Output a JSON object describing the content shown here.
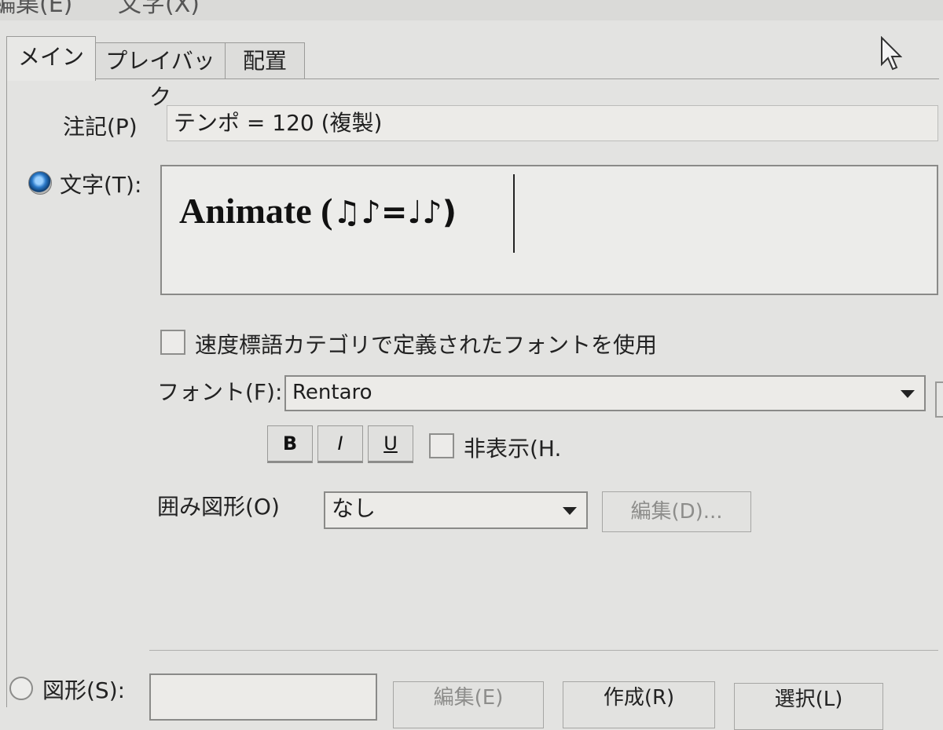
{
  "menubar": {
    "items": [
      "編集(E)",
      "文字(X)"
    ]
  },
  "tabs": [
    {
      "label": "メイン",
      "active": true
    },
    {
      "label": "プレイバック",
      "active": false
    },
    {
      "label": "配置",
      "active": false
    }
  ],
  "annotation": {
    "label": "注記(P)",
    "value": "テンポ = 120 (複製)"
  },
  "text_option": {
    "label": "文字(T):",
    "selected": true,
    "content": "Animate (",
    "content_symbols": "♫♪=♩♪)"
  },
  "tempo_font_checkbox": {
    "label": "速度標語カテゴリで定義されたフォントを使用",
    "checked": false
  },
  "font": {
    "label": "フォント(F):",
    "value": "Rentaro"
  },
  "style_buttons": {
    "bold": "B",
    "italic": "I",
    "underline": "U"
  },
  "hidden_checkbox": {
    "label": "非表示(H.",
    "checked": false
  },
  "enclosure": {
    "label": "囲み図形(O)",
    "value": "なし",
    "edit_button": "編集(D)..."
  },
  "shape_option": {
    "label": "図形(S):",
    "selected": false
  },
  "bottom_buttons": {
    "edit": "編集(E)",
    "create": "作成(R)",
    "select": "選択(L)"
  },
  "colors": {
    "accent": "#2a79c8",
    "background": "#e3e3e1"
  }
}
